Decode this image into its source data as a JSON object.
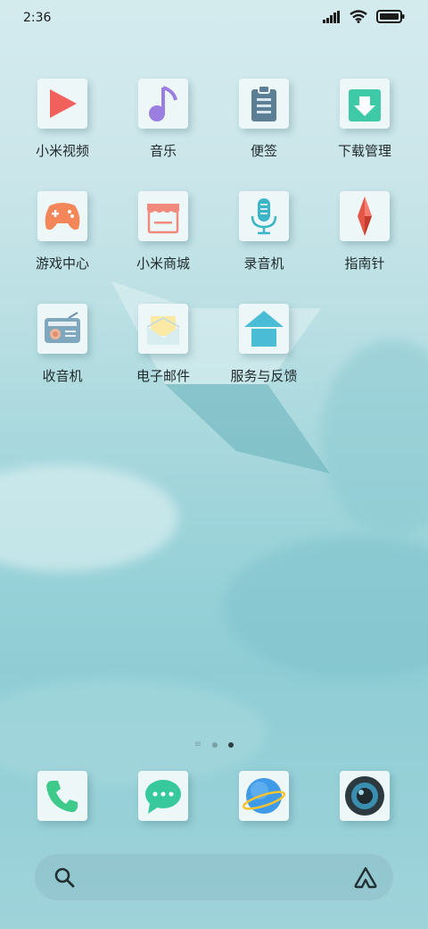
{
  "status_bar": {
    "time": "2:36"
  },
  "apps": [
    {
      "label": "小米视频",
      "icon": "play-icon"
    },
    {
      "label": "音乐",
      "icon": "music-note-icon"
    },
    {
      "label": "便签",
      "icon": "notepad-icon"
    },
    {
      "label": "下载管理",
      "icon": "download-icon"
    },
    {
      "label": "游戏中心",
      "icon": "gamepad-icon"
    },
    {
      "label": "小米商城",
      "icon": "store-icon"
    },
    {
      "label": "录音机",
      "icon": "microphone-icon"
    },
    {
      "label": "指南针",
      "icon": "compass-icon"
    },
    {
      "label": "收音机",
      "icon": "radio-icon"
    },
    {
      "label": "电子邮件",
      "icon": "mail-icon"
    },
    {
      "label": "服务与反馈",
      "icon": "home-icon"
    }
  ],
  "page_indicator": {
    "pages": 2,
    "current": 2
  },
  "dock": [
    {
      "icon": "phone-icon"
    },
    {
      "icon": "messages-icon"
    },
    {
      "icon": "browser-icon"
    },
    {
      "icon": "camera-icon"
    }
  ],
  "search_bar": {
    "icon_left": "search-icon",
    "icon_right": "assistant-icon"
  }
}
